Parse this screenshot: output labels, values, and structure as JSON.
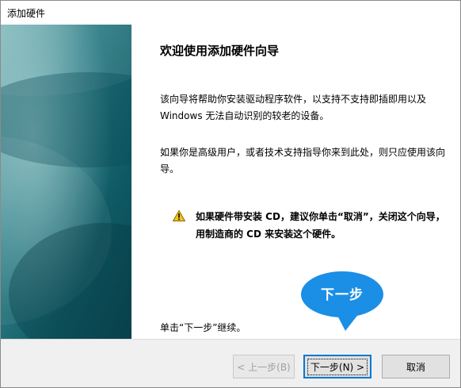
{
  "window": {
    "title": "添加硬件"
  },
  "wizard": {
    "heading": "欢迎使用添加硬件向导",
    "paragraph1": "该向导将帮助你安装驱动程序软件，以支持不支持即插即用以及 Windows 无法自动识别的较老的设备。",
    "paragraph2": "如果你是高级用户，或者技术支持指导你来到此处，则只应使用该向导。",
    "warning": "如果硬件带安装 CD，建议你单击“取消”，关闭这个向导，用制造商的 CD 来安装这个硬件。",
    "callout": "下一步",
    "continue_hint": "单击“下一步”继续。"
  },
  "buttons": {
    "back": "< 上一步(B)",
    "next": "下一步(N) >",
    "cancel": "取消"
  },
  "icons": {
    "warning": "warning-triangle-icon"
  },
  "colors": {
    "banner_dark": "#0a4a55",
    "banner_light": "#5fa3a8",
    "bubble_fill": "#1b8ee6",
    "accent_border": "#0078d7",
    "warning_yellow": "#f2c21b"
  }
}
